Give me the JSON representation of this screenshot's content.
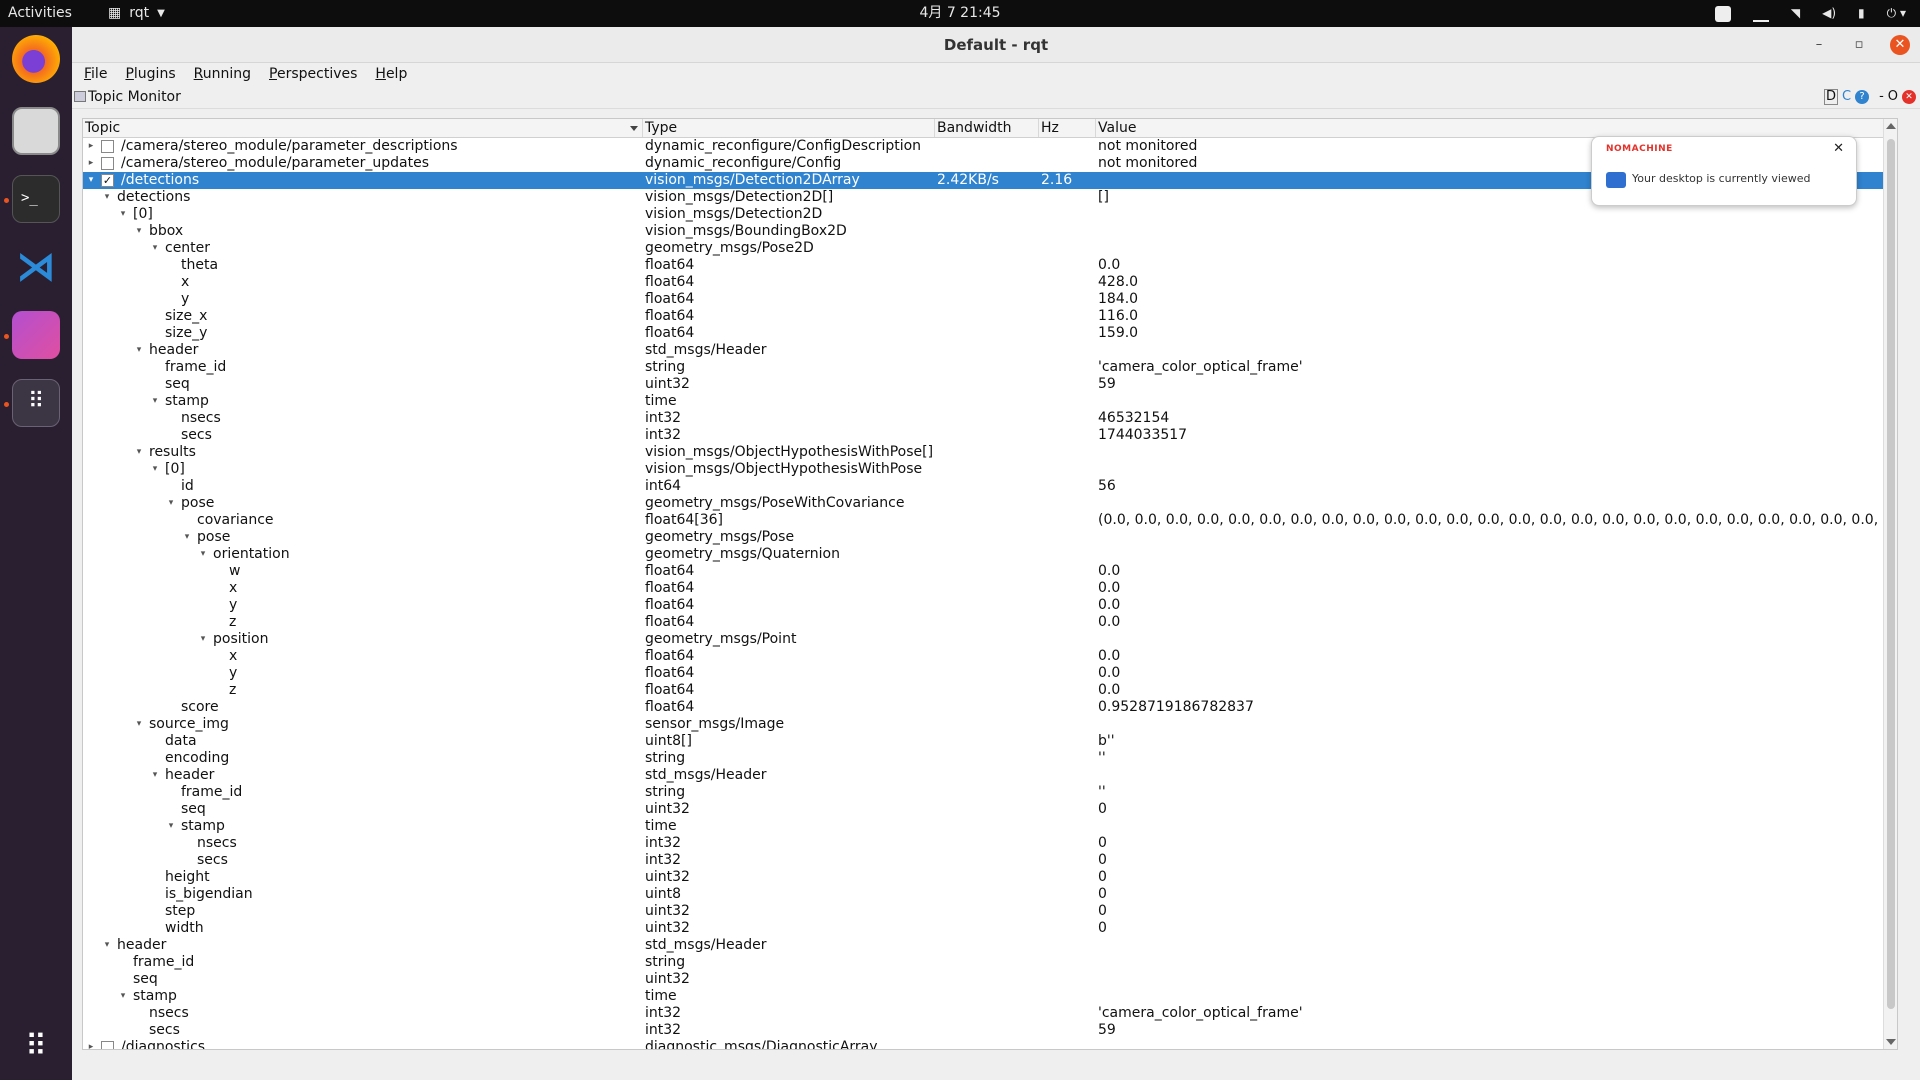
{
  "topbar": {
    "activities": "Activities",
    "app_name": "rqt",
    "clock": "4月 7  21:45"
  },
  "window": {
    "title": "Default - rqt",
    "minimize": "–",
    "maximize": "▫",
    "close": "✕"
  },
  "menu": [
    "File",
    "Plugins",
    "Running",
    "Perspectives",
    "Help"
  ],
  "plugin": {
    "title": "Topic Monitor",
    "controls": [
      "D",
      "C",
      "?",
      "-",
      "O",
      "✕"
    ]
  },
  "columns": {
    "topic": "Topic",
    "type": "Type",
    "bandwidth": "Bandwidth",
    "hz": "Hz",
    "value": "Value"
  },
  "rows": [
    {
      "level": 0,
      "arrow": "▸",
      "checkbox": false,
      "topic": "/camera/stereo_module/parameter_descriptions",
      "type": "dynamic_reconfigure/ConfigDescription",
      "bw": "",
      "hz": "",
      "value": "not monitored"
    },
    {
      "level": 0,
      "arrow": "▸",
      "checkbox": false,
      "topic": "/camera/stereo_module/parameter_updates",
      "type": "dynamic_reconfigure/Config",
      "bw": "",
      "hz": "",
      "value": "not monitored"
    },
    {
      "level": 0,
      "arrow": "▾",
      "checkbox": true,
      "selected": true,
      "topic": "/detections",
      "type": "vision_msgs/Detection2DArray",
      "bw": "2.42KB/s",
      "hz": "2.16",
      "value": ""
    },
    {
      "level": 1,
      "arrow": "▾",
      "topic": "detections",
      "type": "vision_msgs/Detection2D[]",
      "value": "[]"
    },
    {
      "level": 2,
      "arrow": "▾",
      "topic": "[0]",
      "type": "vision_msgs/Detection2D",
      "value": ""
    },
    {
      "level": 3,
      "arrow": "▾",
      "topic": "bbox",
      "type": "vision_msgs/BoundingBox2D",
      "value": ""
    },
    {
      "level": 4,
      "arrow": "▾",
      "topic": "center",
      "type": "geometry_msgs/Pose2D",
      "value": ""
    },
    {
      "level": 5,
      "arrow": "",
      "topic": "theta",
      "type": "float64",
      "value": "0.0"
    },
    {
      "level": 5,
      "arrow": "",
      "topic": "x",
      "type": "float64",
      "value": "428.0"
    },
    {
      "level": 5,
      "arrow": "",
      "topic": "y",
      "type": "float64",
      "value": "184.0"
    },
    {
      "level": 4,
      "arrow": "",
      "topic": "size_x",
      "type": "float64",
      "value": "116.0"
    },
    {
      "level": 4,
      "arrow": "",
      "topic": "size_y",
      "type": "float64",
      "value": "159.0"
    },
    {
      "level": 3,
      "arrow": "▾",
      "topic": "header",
      "type": "std_msgs/Header",
      "value": ""
    },
    {
      "level": 4,
      "arrow": "",
      "topic": "frame_id",
      "type": "string",
      "value": "'camera_color_optical_frame'"
    },
    {
      "level": 4,
      "arrow": "",
      "topic": "seq",
      "type": "uint32",
      "value": "59"
    },
    {
      "level": 4,
      "arrow": "▾",
      "topic": "stamp",
      "type": "time",
      "value": ""
    },
    {
      "level": 5,
      "arrow": "",
      "topic": "nsecs",
      "type": "int32",
      "value": "46532154"
    },
    {
      "level": 5,
      "arrow": "",
      "topic": "secs",
      "type": "int32",
      "value": "1744033517"
    },
    {
      "level": 3,
      "arrow": "▾",
      "topic": "results",
      "type": "vision_msgs/ObjectHypothesisWithPose[]",
      "value": ""
    },
    {
      "level": 4,
      "arrow": "▾",
      "topic": "[0]",
      "type": "vision_msgs/ObjectHypothesisWithPose",
      "value": ""
    },
    {
      "level": 5,
      "arrow": "",
      "topic": "id",
      "type": "int64",
      "value": "56"
    },
    {
      "level": 5,
      "arrow": "▾",
      "topic": "pose",
      "type": "geometry_msgs/PoseWithCovariance",
      "value": ""
    },
    {
      "level": 6,
      "arrow": "",
      "topic": "covariance",
      "type": "float64[36]",
      "value": "(0.0, 0.0, 0.0, 0.0, 0.0, 0.0, 0.0, 0.0, 0.0, 0.0, 0.0, 0.0, 0.0, 0.0, 0.0, 0.0, 0.0, 0.0, 0.0, 0.0, 0.0, 0.0, 0.0, 0.0, 0.0, 0.0, 0.0, 0.0, 0.0, 0.0,..."
    },
    {
      "level": 6,
      "arrow": "▾",
      "topic": "pose",
      "type": "geometry_msgs/Pose",
      "value": ""
    },
    {
      "level": 7,
      "arrow": "▾",
      "topic": "orientation",
      "type": "geometry_msgs/Quaternion",
      "value": ""
    },
    {
      "level": 8,
      "arrow": "",
      "topic": "w",
      "type": "float64",
      "value": "0.0"
    },
    {
      "level": 8,
      "arrow": "",
      "topic": "x",
      "type": "float64",
      "value": "0.0"
    },
    {
      "level": 8,
      "arrow": "",
      "topic": "y",
      "type": "float64",
      "value": "0.0"
    },
    {
      "level": 8,
      "arrow": "",
      "topic": "z",
      "type": "float64",
      "value": "0.0"
    },
    {
      "level": 7,
      "arrow": "▾",
      "topic": "position",
      "type": "geometry_msgs/Point",
      "value": ""
    },
    {
      "level": 8,
      "arrow": "",
      "topic": "x",
      "type": "float64",
      "value": "0.0"
    },
    {
      "level": 8,
      "arrow": "",
      "topic": "y",
      "type": "float64",
      "value": "0.0"
    },
    {
      "level": 8,
      "arrow": "",
      "topic": "z",
      "type": "float64",
      "value": "0.0"
    },
    {
      "level": 5,
      "arrow": "",
      "topic": "score",
      "type": "float64",
      "value": "0.9528719186782837"
    },
    {
      "level": 3,
      "arrow": "▾",
      "topic": "source_img",
      "type": "sensor_msgs/Image",
      "value": ""
    },
    {
      "level": 4,
      "arrow": "",
      "topic": "data",
      "type": "uint8[]",
      "value": "b''"
    },
    {
      "level": 4,
      "arrow": "",
      "topic": "encoding",
      "type": "string",
      "value": "''"
    },
    {
      "level": 4,
      "arrow": "▾",
      "topic": "header",
      "type": "std_msgs/Header",
      "value": ""
    },
    {
      "level": 5,
      "arrow": "",
      "topic": "frame_id",
      "type": "string",
      "value": "''"
    },
    {
      "level": 5,
      "arrow": "",
      "topic": "seq",
      "type": "uint32",
      "value": "0"
    },
    {
      "level": 5,
      "arrow": "▾",
      "topic": "stamp",
      "type": "time",
      "value": ""
    },
    {
      "level": 6,
      "arrow": "",
      "topic": "nsecs",
      "type": "int32",
      "value": "0"
    },
    {
      "level": 6,
      "arrow": "",
      "topic": "secs",
      "type": "int32",
      "value": "0"
    },
    {
      "level": 4,
      "arrow": "",
      "topic": "height",
      "type": "uint32",
      "value": "0"
    },
    {
      "level": 4,
      "arrow": "",
      "topic": "is_bigendian",
      "type": "uint8",
      "value": "0"
    },
    {
      "level": 4,
      "arrow": "",
      "topic": "step",
      "type": "uint32",
      "value": "0"
    },
    {
      "level": 4,
      "arrow": "",
      "topic": "width",
      "type": "uint32",
      "value": "0"
    },
    {
      "level": 1,
      "arrow": "▾",
      "topic": "header",
      "type": "std_msgs/Header",
      "value": ""
    },
    {
      "level": 2,
      "arrow": "",
      "topic": "frame_id",
      "type": "string",
      "value": ""
    },
    {
      "level": 2,
      "arrow": "",
      "topic": "seq",
      "type": "uint32",
      "value": ""
    },
    {
      "level": 2,
      "arrow": "▾",
      "topic": "stamp",
      "type": "time",
      "value": ""
    },
    {
      "level": 3,
      "arrow": "",
      "topic": "nsecs",
      "type": "int32",
      "value": "'camera_color_optical_frame'"
    },
    {
      "level": 3,
      "arrow": "",
      "topic": "secs",
      "type": "int32",
      "value": "59"
    },
    {
      "level": 0,
      "arrow": "▸",
      "checkbox": false,
      "topic": "/diagnostics",
      "type": "diagnostic_msgs/DiagnosticArray",
      "value": ""
    }
  ],
  "notification": {
    "brand": "NOMACHINE",
    "message": "Your desktop is currently viewed",
    "close": "✕"
  },
  "colors": {
    "selection": "#2f83cf",
    "dock_bg": "#2a1f30",
    "topbar_bg": "#0d0d0d",
    "accent": "#e95420"
  },
  "dock_icons": [
    "firefox-icon",
    "files-icon",
    "terminal-icon",
    "vscode-icon",
    "image-viewer-icon",
    "rqt-icon",
    "show-apps-icon"
  ]
}
